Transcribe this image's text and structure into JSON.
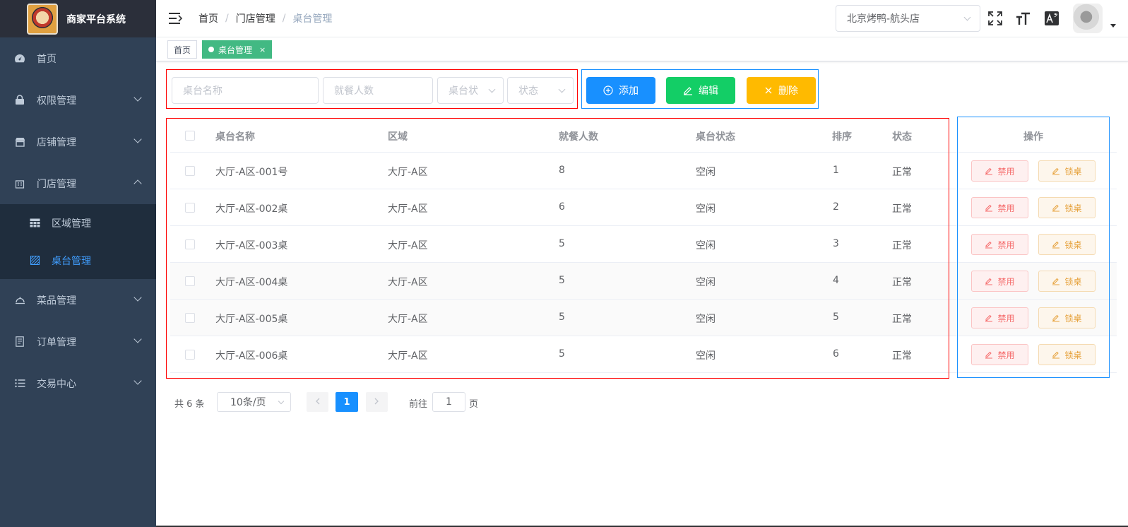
{
  "app": {
    "title": "商家平台系统"
  },
  "sidebar": {
    "items": [
      {
        "label": "首页",
        "icon": "dashboard-icon",
        "has_children": false
      },
      {
        "label": "权限管理",
        "icon": "lock-icon",
        "has_children": true
      },
      {
        "label": "店铺管理",
        "icon": "shop-icon",
        "has_children": true
      },
      {
        "label": "门店管理",
        "icon": "store-icon",
        "has_children": true,
        "expanded": true
      },
      {
        "label": "菜品管理",
        "icon": "dish-cover-icon",
        "has_children": true
      },
      {
        "label": "订单管理",
        "icon": "document-icon",
        "has_children": true
      },
      {
        "label": "交易中心",
        "icon": "list-icon",
        "has_children": true
      }
    ],
    "submenu": [
      {
        "label": "区域管理",
        "icon": "table-grid-icon"
      },
      {
        "label": "桌台管理",
        "icon": "hatched-square-icon",
        "active": true
      }
    ],
    "bg_color": "#304156",
    "active_color": "#409eff"
  },
  "header": {
    "breadcrumb": [
      "首页",
      "门店管理",
      "桌台管理"
    ],
    "store_select": "北京烤鸭-航头店"
  },
  "tags": {
    "home": "首页",
    "active": "桌台管理",
    "close": "×",
    "active_color": "#42b983"
  },
  "filters": {
    "name_placeholder": "桌台名称",
    "people_placeholder": "就餐人数",
    "table_status_placeholder": "桌台状",
    "status_placeholder": "状态"
  },
  "actions": {
    "add": "添加",
    "edit": "编辑",
    "delete": "删除",
    "add_color": "#1890ff",
    "edit_color": "#13ce66",
    "delete_color": "#ffba00"
  },
  "table": {
    "columns": {
      "name": "桌台名称",
      "area": "区域",
      "people": "就餐人数",
      "table_status": "桌台状态",
      "sort": "排序",
      "status": "状态",
      "operation": "操作"
    },
    "rows": [
      {
        "name": "大厅-A区-001号",
        "area": "大厅-A区",
        "people": "8",
        "table_status": "空闲",
        "sort": "1",
        "status": "正常"
      },
      {
        "name": "大厅-A区-002桌",
        "area": "大厅-A区",
        "people": "6",
        "table_status": "空闲",
        "sort": "2",
        "status": "正常"
      },
      {
        "name": "大厅-A区-003桌",
        "area": "大厅-A区",
        "people": "5",
        "table_status": "空闲",
        "sort": "3",
        "status": "正常"
      },
      {
        "name": "大厅-A区-004桌",
        "area": "大厅-A区",
        "people": "5",
        "table_status": "空闲",
        "sort": "4",
        "status": "正常"
      },
      {
        "name": "大厅-A区-005桌",
        "area": "大厅-A区",
        "people": "5",
        "table_status": "空闲",
        "sort": "5",
        "status": "正常"
      },
      {
        "name": "大厅-A区-006桌",
        "area": "大厅-A区",
        "people": "5",
        "table_status": "空闲",
        "sort": "6",
        "status": "正常"
      }
    ],
    "disable_label": "禁用",
    "lock_label": "锁桌"
  },
  "pagination": {
    "total": "共 6 条",
    "page_size": "10条/页",
    "current_page": "1",
    "goto": "前往",
    "goto_value": "1",
    "page_suffix": "页"
  }
}
